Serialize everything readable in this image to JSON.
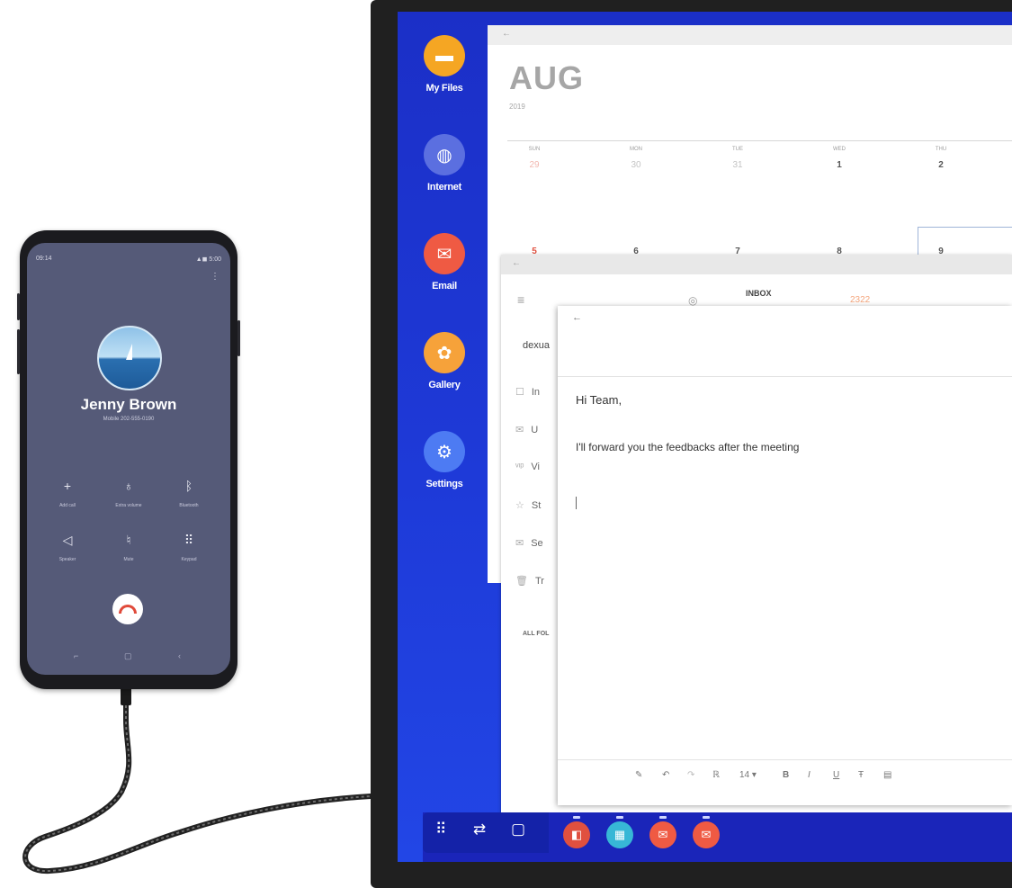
{
  "phone": {
    "status_time": "09:14",
    "status_right": "▲◼ 5:00",
    "contact_name": "Jenny Brown",
    "contact_sub": "Mobile  202-555-0190",
    "buttons_row1": [
      "Add call",
      "Extra volume",
      "Bluetooth"
    ],
    "buttons_row2": [
      "Speaker",
      "Mute",
      "Keypad"
    ]
  },
  "sidebar": {
    "apps": [
      {
        "label": "My Files",
        "icon": "folder-icon",
        "color": "#f5a623"
      },
      {
        "label": "Internet",
        "icon": "globe-icon",
        "color": "#5b6fe0"
      },
      {
        "label": "Email",
        "icon": "mail-icon",
        "color": "#ef5a43"
      },
      {
        "label": "Gallery",
        "icon": "flower-icon",
        "color": "#f6a23a"
      },
      {
        "label": "Settings",
        "icon": "gear-icon",
        "color": "#4d7bf3"
      }
    ]
  },
  "calendar": {
    "month": "AUG",
    "year": "2019",
    "days_of_week": [
      "SUN",
      "MON",
      "TUE",
      "WED",
      "THU"
    ],
    "week1": [
      "29",
      "30",
      "31",
      "1",
      "2"
    ],
    "week2": [
      "5",
      "6",
      "7",
      "8",
      "9"
    ]
  },
  "mail": {
    "inbox_label": "INBOX",
    "account": "dexua",
    "rows": [
      "In",
      "U",
      "Vi",
      "St",
      "Se",
      "Tr"
    ],
    "all_folders": "ALL FOL",
    "tag": "2322"
  },
  "compose": {
    "greeting": "Hi Team,",
    "body": "I'll forward you the feedbacks after the meeting",
    "font_size": "14 ▾"
  },
  "colors": {
    "desktop_blue": "#1e3ad8",
    "phone_screen": "#555a78"
  }
}
